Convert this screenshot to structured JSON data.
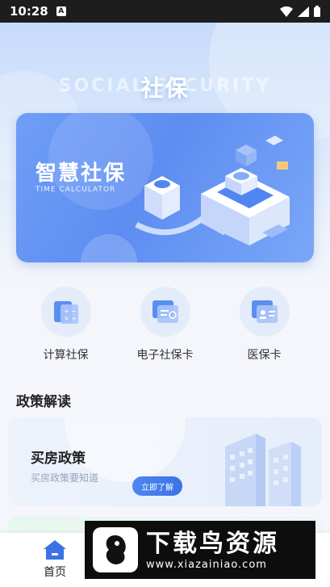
{
  "status_bar": {
    "time": "10:28",
    "notif_glyph": "A"
  },
  "hero": {
    "watermark": "SOCIAL SECURITY",
    "title": "社保"
  },
  "banner": {
    "title": "智慧社保",
    "subtitle": "TIME CALCULATOR"
  },
  "services": [
    {
      "label": "计算社保",
      "icon": "calculator-icon"
    },
    {
      "label": "电子社保卡",
      "icon": "social-card-icon"
    },
    {
      "label": "医保卡",
      "icon": "medical-card-icon"
    }
  ],
  "policy_section": {
    "title": "政策解读"
  },
  "policy_card": {
    "title": "买房政策",
    "subtitle": "买房政策要知道",
    "button": "立即了解"
  },
  "tabbar": {
    "home_label": "首页"
  },
  "overlay_ad": {
    "text": "下载鸟资源",
    "url": "www.xiazainiao.com"
  },
  "colors": {
    "accent": "#4f86f0",
    "banner": "#6f9ef6"
  }
}
